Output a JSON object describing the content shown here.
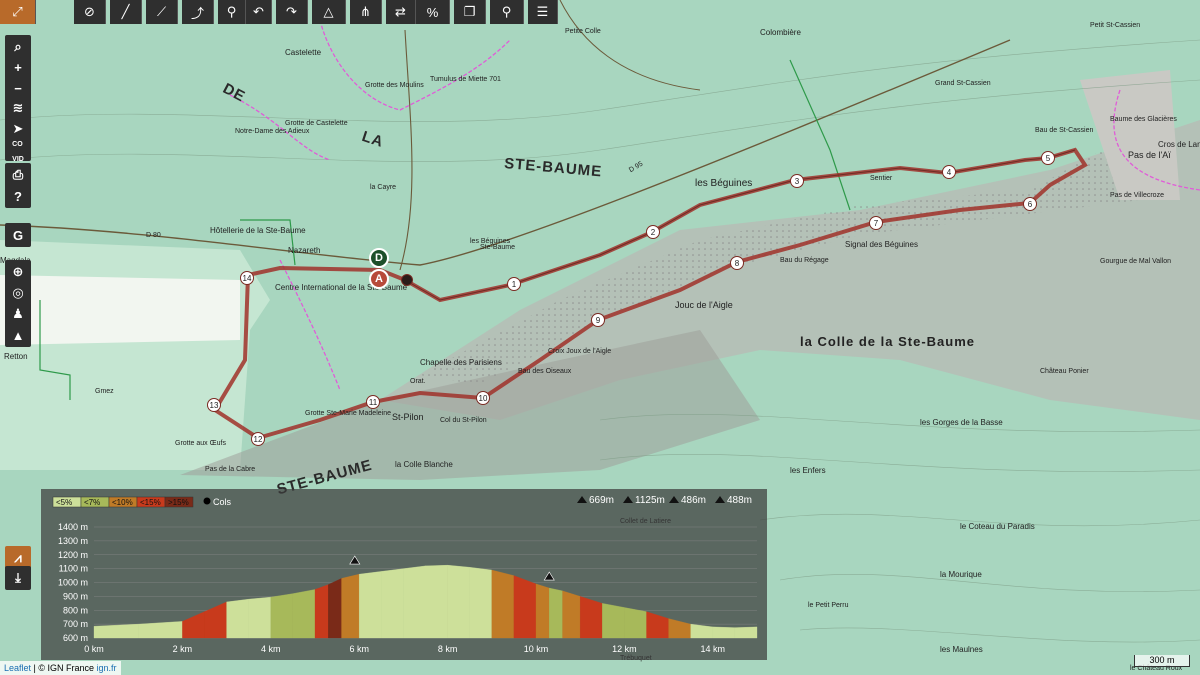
{
  "toolbar": {
    "buttons": [
      {
        "icon": "layers-expand-icon",
        "color": "#b86a2a"
      },
      {
        "icon": "eye-off-icon"
      },
      {
        "icon": "draw-line-icon"
      },
      {
        "icon": "route-icon"
      },
      {
        "icon": "route-node-icon"
      },
      {
        "icon": "bike-icon"
      },
      {
        "icon": "undo-icon"
      },
      {
        "icon": "redo-icon"
      },
      {
        "icon": "triangle-nodes-icon"
      },
      {
        "icon": "tree-nodes-icon"
      },
      {
        "icon": "swap-icon"
      },
      {
        "icon": "percent-icon"
      },
      {
        "icon": "copy-icon"
      },
      {
        "icon": "pin-icon"
      },
      {
        "icon": "menu-icon"
      }
    ]
  },
  "sidebar": {
    "buttons": [
      {
        "icon": "search-icon",
        "label": ""
      },
      {
        "icon": "zoom-in-icon",
        "label": "+"
      },
      {
        "icon": "zoom-out-icon",
        "label": "−"
      },
      {
        "icon": "layers-icon",
        "label": ""
      },
      {
        "icon": "locate-icon",
        "label": ""
      },
      {
        "icon": "covid-icon",
        "label": "CO\nVID"
      },
      {
        "icon": "print-icon",
        "label": ""
      },
      {
        "icon": "help-icon",
        "label": "?"
      },
      {
        "icon": "google-icon",
        "label": "G"
      },
      {
        "icon": "crosshair-icon",
        "label": ""
      },
      {
        "icon": "globe-icon",
        "label": ""
      },
      {
        "icon": "hiker-icon",
        "label": ""
      },
      {
        "icon": "mountain-icon",
        "label": ""
      },
      {
        "icon": "profile-chart-icon",
        "label": ""
      },
      {
        "icon": "download-icon",
        "label": ""
      }
    ]
  },
  "map_labels": [
    {
      "t": "Castelette",
      "c": "#222",
      "fs": 8
    },
    {
      "t": "Grotte de Castelette",
      "c": "#222",
      "fs": 7
    },
    {
      "t": "Notre-Dame des Adieux",
      "c": "#222",
      "fs": 7
    },
    {
      "t": "Tumulus de Miette 701",
      "c": "#222",
      "fs": 7
    },
    {
      "t": "Grotte des Moulins",
      "c": "#222",
      "fs": 7
    },
    {
      "t": "Petite Colle",
      "c": "#222",
      "fs": 7
    },
    {
      "t": "Colombière",
      "c": "#222",
      "fs": 8
    },
    {
      "t": "Petit St-Cassien",
      "c": "#222",
      "fs": 7
    },
    {
      "t": "Grand St-Cassien",
      "c": "#222",
      "fs": 7
    },
    {
      "t": "Baume des Glacières",
      "c": "#222",
      "fs": 7
    },
    {
      "t": "STE-BAUME",
      "c": "#2a2a2a",
      "fs": 15
    },
    {
      "t": "DE",
      "c": "#2a2a2a",
      "fs": 15
    },
    {
      "t": "LA",
      "c": "#2a2a2a",
      "fs": 15
    },
    {
      "t": "les Béguines",
      "c": "#222",
      "fs": 10
    },
    {
      "t": "Bau de St-Cassien",
      "c": "#222",
      "fs": 7
    },
    {
      "t": "Pas de l'Aï",
      "c": "#222",
      "fs": 9
    },
    {
      "t": "Cros de Lans",
      "c": "#222",
      "fs": 8
    },
    {
      "t": "Pas de Villecroze",
      "c": "#222",
      "fs": 7
    },
    {
      "t": "Sentier",
      "c": "#222",
      "fs": 7
    },
    {
      "t": "la Cayre",
      "c": "#222",
      "fs": 7
    },
    {
      "t": "Hôtellerie de la Ste-Baume",
      "c": "#222",
      "fs": 8
    },
    {
      "t": "Nazareth",
      "c": "#222",
      "fs": 8
    },
    {
      "t": "Magdala",
      "c": "#222",
      "fs": 8
    },
    {
      "t": "les Béguines",
      "c": "#222",
      "fs": 7
    },
    {
      "t": "Signal des Béguines",
      "c": "#222",
      "fs": 8
    },
    {
      "t": "Bau du Régage",
      "c": "#222",
      "fs": 7
    },
    {
      "t": "Gourgue de Mal Vallon",
      "c": "#222",
      "fs": 7
    },
    {
      "t": "Centre International de la Ste-Baume",
      "c": "#222",
      "fs": 8
    },
    {
      "t": "Jouc de l'Aigle",
      "c": "#222",
      "fs": 9
    },
    {
      "t": "la Colle de la Ste-Baume",
      "c": "#222",
      "fs": 13
    },
    {
      "t": "Chapelle des Parisiens",
      "c": "#222",
      "fs": 8
    },
    {
      "t": "Orat.",
      "c": "#222",
      "fs": 7
    },
    {
      "t": "Bau des Oiseaux",
      "c": "#222",
      "fs": 7
    },
    {
      "t": "Croix Joux de l'Aigle",
      "c": "#222",
      "fs": 7
    },
    {
      "t": "Château Ponier",
      "c": "#222",
      "fs": 7
    },
    {
      "t": "Grotte Ste-Marie Madeleine",
      "c": "#222",
      "fs": 7
    },
    {
      "t": "St-Pilon",
      "c": "#222",
      "fs": 9
    },
    {
      "t": "Col du St-Pilon",
      "c": "#222",
      "fs": 7
    },
    {
      "t": "Grotte aux Œufs",
      "c": "#222",
      "fs": 7
    },
    {
      "t": "Pas de la Cabre",
      "c": "#222",
      "fs": 7
    },
    {
      "t": "la Colle Blanche",
      "c": "#222",
      "fs": 8
    },
    {
      "t": "STE-BAUME",
      "c": "#2a2a2a",
      "fs": 15
    },
    {
      "t": "les Gorges de la Basse",
      "c": "#222",
      "fs": 8
    },
    {
      "t": "les Enfers",
      "c": "#222",
      "fs": 8
    },
    {
      "t": "le Coteau du Paradis",
      "c": "#222",
      "fs": 8
    },
    {
      "t": "la Mourique",
      "c": "#222",
      "fs": 8
    },
    {
      "t": "le Petit Perru",
      "c": "#222",
      "fs": 7
    },
    {
      "t": "les Maulnes",
      "c": "#222",
      "fs": 8
    },
    {
      "t": "le Château Roux",
      "c": "#222",
      "fs": 7
    },
    {
      "t": "Trébuquet",
      "c": "#222",
      "fs": 7
    },
    {
      "t": "Collet de Latiere",
      "c": "#222",
      "fs": 7
    },
    {
      "t": "D 95",
      "c": "#222",
      "fs": 7
    },
    {
      "t": "D 80",
      "c": "#222",
      "fs": 7
    },
    {
      "t": "Gmez",
      "c": "#222",
      "fs": 7
    },
    {
      "t": "Retton",
      "c": "#222",
      "fs": 8
    },
    {
      "t": "Ste-Baume",
      "c": "#222",
      "fs": 7
    }
  ],
  "route_markers": {
    "start_label": "D",
    "end_label": "A",
    "waypoints": [
      "1",
      "2",
      "3",
      "4",
      "5",
      "6",
      "7",
      "8",
      "9",
      "10",
      "11",
      "12",
      "13",
      "14"
    ]
  },
  "profile": {
    "legend": [
      {
        "label": "<5%",
        "color": "#cde09a"
      },
      {
        "label": "<7%",
        "color": "#a7b95a"
      },
      {
        "label": "<10%",
        "color": "#c07b27"
      },
      {
        "label": "<15%",
        "color": "#c83a1c"
      },
      {
        "label": ">15%",
        "color": "#7a2a18"
      }
    ],
    "cols_label": "Cols",
    "stats": [
      {
        "icon": "min-alt-icon",
        "value": "669m"
      },
      {
        "icon": "max-alt-icon",
        "value": "1125m"
      },
      {
        "icon": "ascent-icon",
        "value": "486m"
      },
      {
        "icon": "descent-icon",
        "value": "488m"
      }
    ]
  },
  "chart_data": {
    "type": "area",
    "title": "",
    "xlabel": "",
    "ylabel": "",
    "xlim": [
      0,
      15
    ],
    "ylim": [
      600,
      1400
    ],
    "x_ticks": [
      "0 km",
      "2 km",
      "4 km",
      "6 km",
      "8 km",
      "10 km",
      "12 km",
      "14 km"
    ],
    "y_ticks": [
      "600 m",
      "700 m",
      "800 m",
      "900 m",
      "1000 m",
      "1100 m",
      "1200 m",
      "1300 m",
      "1400 m"
    ],
    "x": [
      0,
      1,
      2,
      2.5,
      3,
      3.5,
      4,
      4.5,
      5,
      5.3,
      5.6,
      6,
      6.5,
      7,
      7.5,
      8,
      8.5,
      9,
      9.5,
      10,
      10.3,
      10.6,
      11,
      11.5,
      12,
      12.5,
      13,
      13.5,
      14,
      14.5,
      15
    ],
    "y": [
      685,
      700,
      720,
      790,
      860,
      880,
      895,
      920,
      950,
      985,
      1030,
      1060,
      1080,
      1100,
      1120,
      1125,
      1110,
      1090,
      1050,
      990,
      960,
      940,
      900,
      850,
      820,
      790,
      740,
      700,
      680,
      675,
      680
    ],
    "markers": [
      {
        "km": 5.9,
        "alt": 1075,
        "icon": "col-marker-icon"
      },
      {
        "km": 10.3,
        "alt": 960,
        "icon": "col-marker-icon"
      }
    ]
  },
  "scale_bar": "300 m",
  "attribution": {
    "leaflet": "Leaflet",
    "sep": " | © IGN France",
    "link": "ign.fr"
  }
}
